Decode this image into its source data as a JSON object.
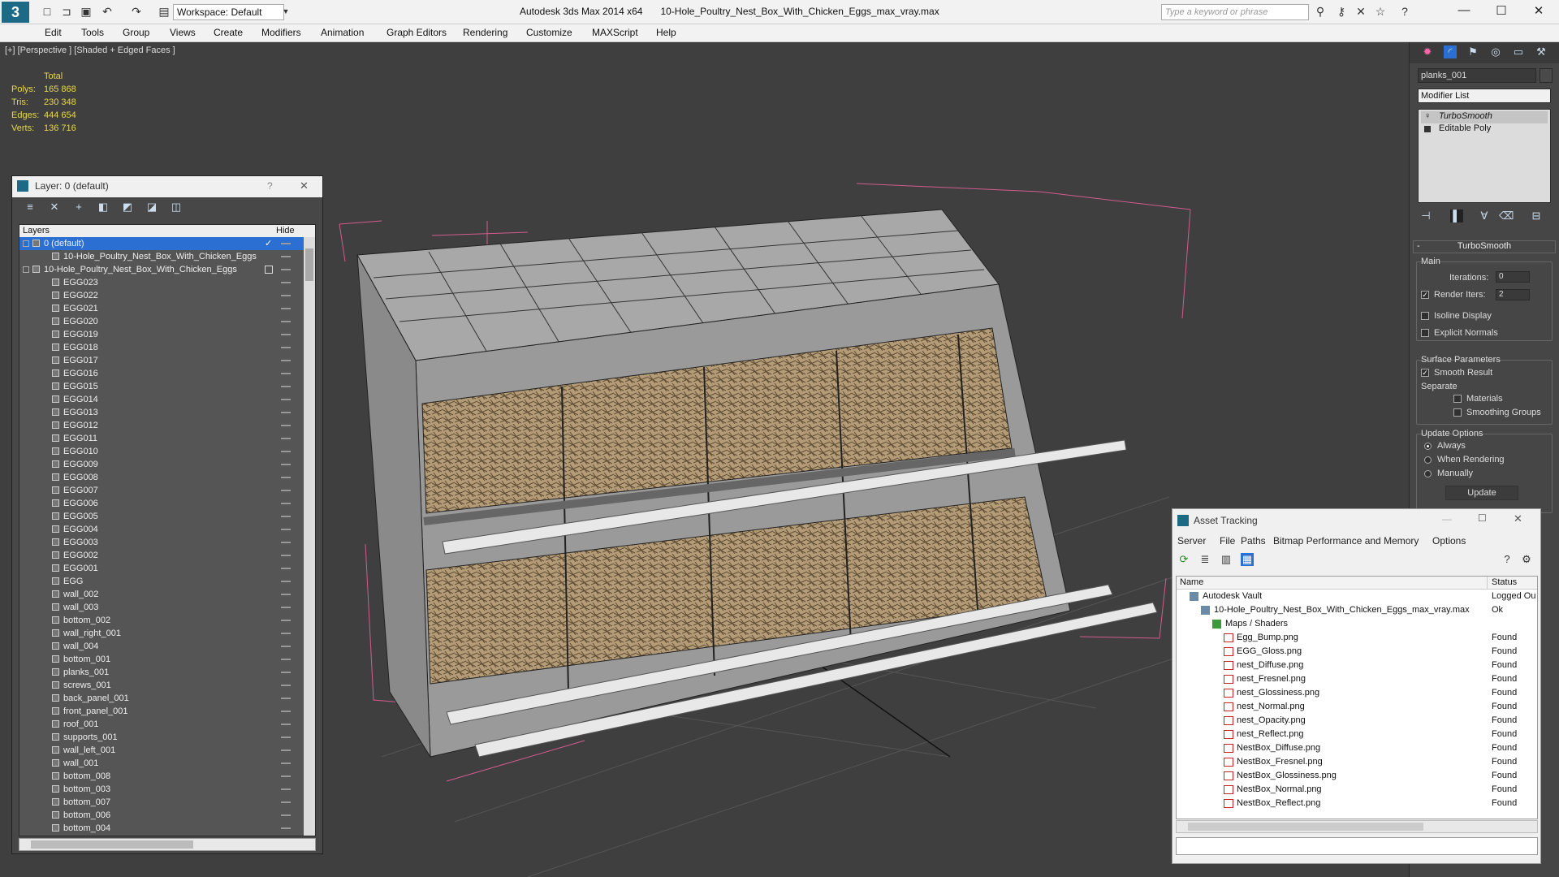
{
  "window": {
    "app": "Autodesk 3ds Max 2014 x64",
    "file": "10-Hole_Poultry_Nest_Box_With_Chicken_Eggs_max_vray.max",
    "workspace": "Workspace: Default",
    "search_placeholder": "Type a keyword or phrase"
  },
  "menu": [
    "Edit",
    "Tools",
    "Group",
    "Views",
    "Create",
    "Modifiers",
    "Animation",
    "Graph Editors",
    "Rendering",
    "Customize",
    "MAXScript",
    "Help"
  ],
  "viewport": {
    "label": "[+] [Perspective ] [Shaded + Edged Faces ]",
    "stats": {
      "header": "Total",
      "rows": [
        {
          "k": "Polys:",
          "v": "165 868"
        },
        {
          "k": "Tris:",
          "v": "230 348"
        },
        {
          "k": "Edges:",
          "v": "444 654"
        },
        {
          "k": "Verts:",
          "v": "136 716"
        }
      ]
    }
  },
  "layer": {
    "title": "Layer: 0 (default)",
    "help": "?",
    "col_layers": "Layers",
    "col_hide": "Hide",
    "rows": [
      {
        "t": "0 (default)",
        "lvl": 0,
        "sel": true,
        "check": true
      },
      {
        "t": "10-Hole_Poultry_Nest_Box_With_Chicken_Eggs",
        "lvl": 1
      },
      {
        "t": "10-Hole_Poultry_Nest_Box_With_Chicken_Eggs",
        "lvl": 0,
        "box": true
      },
      {
        "t": "EGG023",
        "lvl": 1
      },
      {
        "t": "EGG022",
        "lvl": 1
      },
      {
        "t": "EGG021",
        "lvl": 1
      },
      {
        "t": "EGG020",
        "lvl": 1
      },
      {
        "t": "EGG019",
        "lvl": 1
      },
      {
        "t": "EGG018",
        "lvl": 1
      },
      {
        "t": "EGG017",
        "lvl": 1
      },
      {
        "t": "EGG016",
        "lvl": 1
      },
      {
        "t": "EGG015",
        "lvl": 1
      },
      {
        "t": "EGG014",
        "lvl": 1
      },
      {
        "t": "EGG013",
        "lvl": 1
      },
      {
        "t": "EGG012",
        "lvl": 1
      },
      {
        "t": "EGG011",
        "lvl": 1
      },
      {
        "t": "EGG010",
        "lvl": 1
      },
      {
        "t": "EGG009",
        "lvl": 1
      },
      {
        "t": "EGG008",
        "lvl": 1
      },
      {
        "t": "EGG007",
        "lvl": 1
      },
      {
        "t": "EGG006",
        "lvl": 1
      },
      {
        "t": "EGG005",
        "lvl": 1
      },
      {
        "t": "EGG004",
        "lvl": 1
      },
      {
        "t": "EGG003",
        "lvl": 1
      },
      {
        "t": "EGG002",
        "lvl": 1
      },
      {
        "t": "EGG001",
        "lvl": 1
      },
      {
        "t": "EGG",
        "lvl": 1
      },
      {
        "t": "wall_002",
        "lvl": 1
      },
      {
        "t": "wall_003",
        "lvl": 1
      },
      {
        "t": "bottom_002",
        "lvl": 1
      },
      {
        "t": "wall_right_001",
        "lvl": 1
      },
      {
        "t": "wall_004",
        "lvl": 1
      },
      {
        "t": "bottom_001",
        "lvl": 1
      },
      {
        "t": "planks_001",
        "lvl": 1
      },
      {
        "t": "screws_001",
        "lvl": 1
      },
      {
        "t": "back_panel_001",
        "lvl": 1
      },
      {
        "t": "front_panel_001",
        "lvl": 1
      },
      {
        "t": "roof_001",
        "lvl": 1
      },
      {
        "t": "supports_001",
        "lvl": 1
      },
      {
        "t": "wall_left_001",
        "lvl": 1
      },
      {
        "t": "wall_001",
        "lvl": 1
      },
      {
        "t": "bottom_008",
        "lvl": 1
      },
      {
        "t": "bottom_003",
        "lvl": 1
      },
      {
        "t": "bottom_007",
        "lvl": 1
      },
      {
        "t": "bottom_006",
        "lvl": 1
      },
      {
        "t": "bottom_004",
        "lvl": 1
      }
    ]
  },
  "cmd": {
    "object_name": "planks_001",
    "modifier_list": "Modifier List",
    "stack": [
      "TurboSmooth",
      "Editable Poly"
    ],
    "rollout": "TurboSmooth",
    "main": "Main",
    "iterations_label": "Iterations:",
    "iterations": "0",
    "render_iters_label": "Render Iters:",
    "render_iters": "2",
    "isoline": "Isoline Display",
    "explicit": "Explicit Normals",
    "surface": "Surface Parameters",
    "smooth_result": "Smooth Result",
    "separate": "Separate",
    "materials": "Materials",
    "smoothing_groups": "Smoothing Groups",
    "update_options": "Update Options",
    "always": "Always",
    "when_rendering": "When Rendering",
    "manually": "Manually",
    "update": "Update"
  },
  "asset": {
    "title": "Asset Tracking",
    "menu": [
      "Server",
      "File",
      "Paths",
      "Bitmap Performance and Memory",
      "Options"
    ],
    "col_name": "Name",
    "col_status": "Status",
    "rows": [
      {
        "n": "Autodesk Vault",
        "s": "Logged Ou",
        "lvl": 0,
        "icon": "vault"
      },
      {
        "n": "10-Hole_Poultry_Nest_Box_With_Chicken_Eggs_max_vray.max",
        "s": "Ok",
        "lvl": 1,
        "icon": "max"
      },
      {
        "n": "Maps / Shaders",
        "s": "",
        "lvl": 2,
        "icon": "maps"
      },
      {
        "n": "Egg_Bump.png",
        "s": "Found",
        "lvl": 3,
        "icon": "png"
      },
      {
        "n": "EGG_Gloss.png",
        "s": "Found",
        "lvl": 3,
        "icon": "png"
      },
      {
        "n": "nest_Diffuse.png",
        "s": "Found",
        "lvl": 3,
        "icon": "png"
      },
      {
        "n": "nest_Fresnel.png",
        "s": "Found",
        "lvl": 3,
        "icon": "png"
      },
      {
        "n": "nest_Glossiness.png",
        "s": "Found",
        "lvl": 3,
        "icon": "png"
      },
      {
        "n": "nest_Normal.png",
        "s": "Found",
        "lvl": 3,
        "icon": "png"
      },
      {
        "n": "nest_Opacity.png",
        "s": "Found",
        "lvl": 3,
        "icon": "png"
      },
      {
        "n": "nest_Reflect.png",
        "s": "Found",
        "lvl": 3,
        "icon": "png"
      },
      {
        "n": "NestBox_Diffuse.png",
        "s": "Found",
        "lvl": 3,
        "icon": "png"
      },
      {
        "n": "NestBox_Fresnel.png",
        "s": "Found",
        "lvl": 3,
        "icon": "png"
      },
      {
        "n": "NestBox_Glossiness.png",
        "s": "Found",
        "lvl": 3,
        "icon": "png"
      },
      {
        "n": "NestBox_Normal.png",
        "s": "Found",
        "lvl": 3,
        "icon": "png"
      },
      {
        "n": "NestBox_Reflect.png",
        "s": "Found",
        "lvl": 3,
        "icon": "png"
      }
    ]
  }
}
